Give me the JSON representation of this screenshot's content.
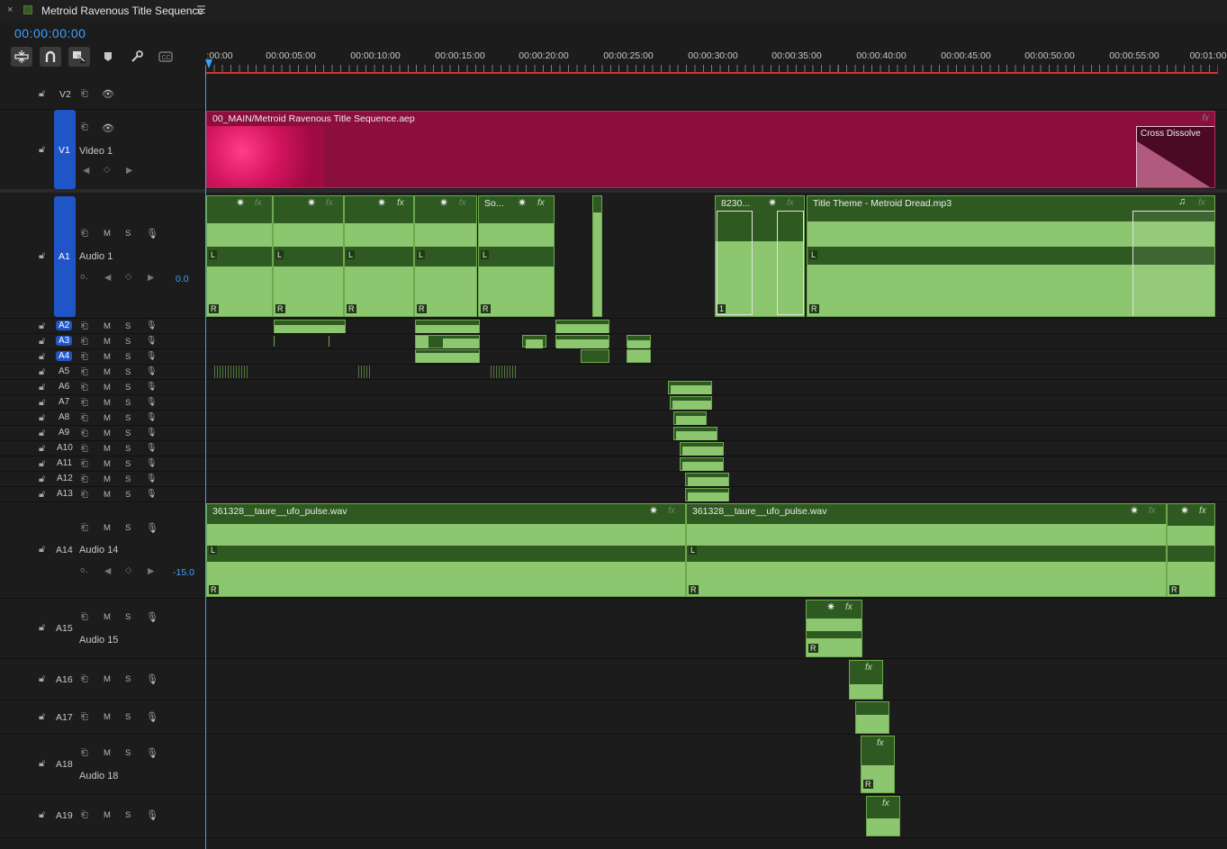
{
  "sequence": {
    "title": "Metroid Ravenous Title Sequence",
    "close_glyph": "×",
    "menu_glyph": "☰",
    "timecode": "00:00:00:00"
  },
  "toolbar": {
    "icons": [
      "insert-nest-icon",
      "snap-magnet-icon",
      "linked-selection-icon",
      "add-marker-icon",
      "wrench-icon",
      "captions-icon"
    ]
  },
  "ruler": {
    "labels": [
      ":00:00",
      "00:00:05:00",
      "00:00:10:00",
      "00:00:15:00",
      "00:00:20:00",
      "00:00:25:00",
      "00:00:30:00",
      "00:00:35:00",
      "00:00:40:00",
      "00:00:45:00",
      "00:00:50:00",
      "00:00:55:00",
      "00:01:00"
    ]
  },
  "header_glyphs": {
    "mute": "M",
    "solo": "S"
  },
  "tracks": {
    "v2": {
      "name": "V2"
    },
    "v1": {
      "name": "V1",
      "label": "Video 1"
    },
    "a1": {
      "name": "A1",
      "label": "Audio 1",
      "volume": "0.0"
    },
    "small": [
      {
        "name": "A2",
        "active": true
      },
      {
        "name": "A3",
        "active": true
      },
      {
        "name": "A4",
        "active": true
      },
      {
        "name": "A5",
        "active": false
      },
      {
        "name": "A6",
        "active": false
      },
      {
        "name": "A7",
        "active": false
      },
      {
        "name": "A8",
        "active": false
      },
      {
        "name": "A9",
        "active": false
      },
      {
        "name": "A10",
        "active": false
      },
      {
        "name": "A11",
        "active": false
      },
      {
        "name": "A12",
        "active": false
      },
      {
        "name": "A13",
        "active": false
      }
    ],
    "a14": {
      "name": "A14",
      "label": "Audio 14",
      "volume": "-15.0"
    },
    "a15": {
      "name": "A15",
      "label": "Audio 15"
    },
    "a16": {
      "name": "A16"
    },
    "a17": {
      "name": "A17"
    },
    "a18": {
      "name": "A18",
      "label": "Audio 18"
    },
    "a19": {
      "name": "A19"
    }
  },
  "clips": {
    "v1_main": "00_MAIN/Metroid Ravenous Title Sequence.aep",
    "v1_transition": "Cross Dissolve",
    "a1_short": "So...",
    "a1_numbered": "8230...",
    "a1_theme": "Title Theme - Metroid Dread.mp3",
    "a14_pulse_1": "361328__taure__ufo_pulse.wav",
    "a14_pulse_2": "361328__taure__ufo_pulse.wav",
    "fx_glyph": "fx",
    "keyframe_glyph": "✷",
    "channel_left": "L",
    "channel_right": "R",
    "channel_one": "1",
    "music_glyph": "♫"
  },
  "colors": {
    "playhead": "#3ea0ff",
    "active_track": "#2055c8",
    "video_clip": "#8b0e3d",
    "audio_clip": "#2e5a21",
    "audio_wave": "#8cc66e",
    "in_out_bar": "#d93030"
  }
}
